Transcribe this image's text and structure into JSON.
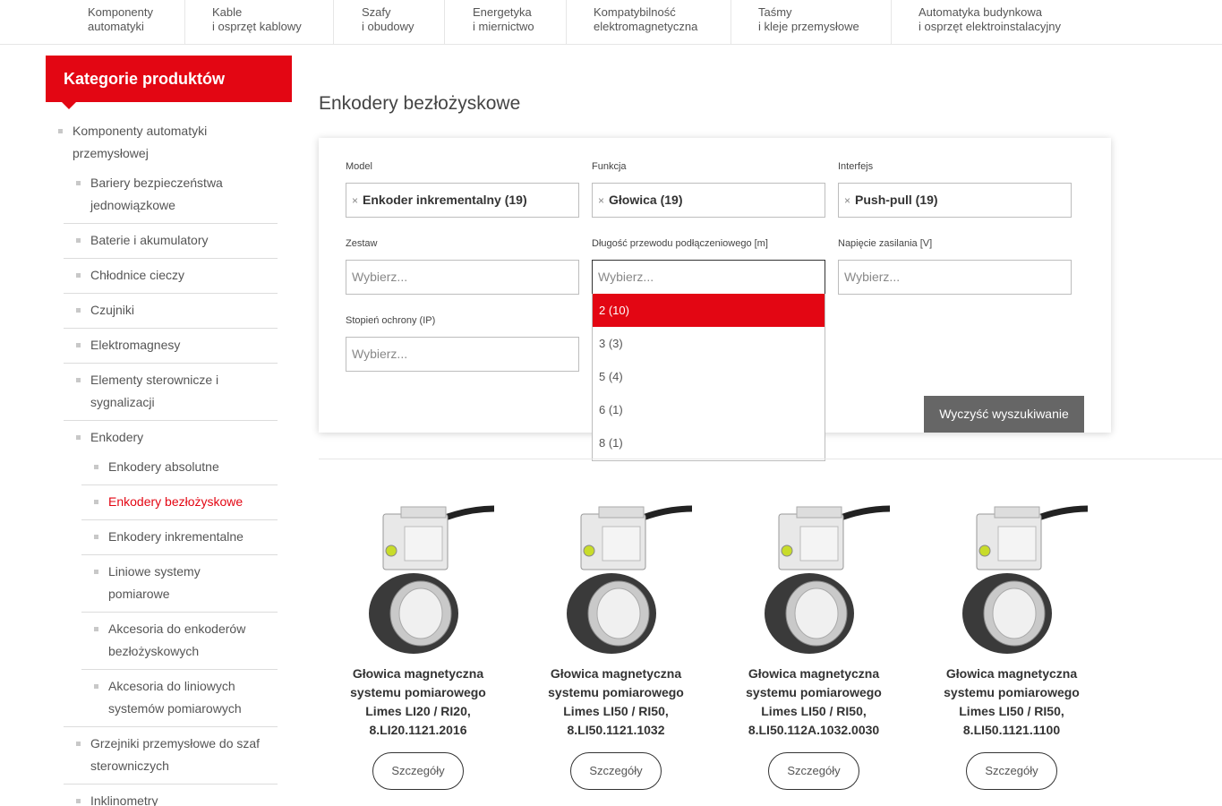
{
  "nav": [
    {
      "line1": "Komponenty",
      "line2": "automatyki"
    },
    {
      "line1": "Kable",
      "line2": "i osprzęt kablowy"
    },
    {
      "line1": "Szafy",
      "line2": "i obudowy"
    },
    {
      "line1": "Energetyka",
      "line2": "i miernictwo"
    },
    {
      "line1": "Kompatybilność",
      "line2": "elektromagnetyczna"
    },
    {
      "line1": "Taśmy",
      "line2": "i kleje przemysłowe"
    },
    {
      "line1": "Automatyka budynkowa",
      "line2": "i osprzęt elektroinstalacyjny"
    }
  ],
  "sidebar": {
    "title": "Kategorie produktów",
    "root": {
      "line1": "Komponenty automatyki",
      "line2": "przemysłowej"
    },
    "items": [
      {
        "line1": "Bariery bezpieczeństwa",
        "line2": "jednowiązkowe"
      },
      {
        "line1": "Baterie i akumulatory"
      },
      {
        "line1": "Chłodnice cieczy"
      },
      {
        "line1": "Czujniki"
      },
      {
        "line1": "Elektromagnesy"
      },
      {
        "line1": "Elementy sterownicze i",
        "line2": "sygnalizacji"
      },
      {
        "line1": "Enkodery"
      }
    ],
    "sub": [
      {
        "line1": "Enkodery absolutne"
      },
      {
        "line1": "Enkodery bezłożyskowe"
      },
      {
        "line1": "Enkodery inkrementalne"
      },
      {
        "line1": "Liniowe systemy",
        "line2": "pomiarowe"
      },
      {
        "line1": "Akcesoria do enkoderów",
        "line2": "bezłożyskowych"
      },
      {
        "line1": "Akcesoria do liniowych",
        "line2": "systemów pomiarowych"
      }
    ],
    "after": [
      {
        "line1": "Grzejniki przemysłowe do szaf",
        "line2": "sterowniczych"
      },
      {
        "line1": "Inklinometry"
      }
    ]
  },
  "page_title": "Enkodery bezłożyskowe",
  "filters": {
    "model": {
      "label": "Model",
      "value": "Enkoder inkrementalny (19)"
    },
    "funkcja": {
      "label": "Funkcja",
      "value": "Głowica (19)"
    },
    "interfejs": {
      "label": "Interfejs",
      "value": "Push-pull (19)"
    },
    "zestaw": {
      "label": "Zestaw",
      "placeholder": "Wybierz..."
    },
    "dlugosc": {
      "label": "Długość przewodu podłączeniowego [m]",
      "placeholder": "Wybierz..."
    },
    "napiecie": {
      "label": "Napięcie zasilania [V]",
      "placeholder": "Wybierz..."
    },
    "ip": {
      "label": "Stopień ochrony (IP)",
      "placeholder": "Wybierz..."
    },
    "remove_symbol": "×",
    "dropdown_options": [
      "2 (10)",
      "3 (3)",
      "5 (4)",
      "6 (1)",
      "8 (1)"
    ],
    "clear_label": "Wyczyść wyszukiwanie"
  },
  "products": [
    {
      "line1": "Głowica magnetyczna",
      "line2": "systemu pomiarowego",
      "line3": "Limes LI20 / RI20,",
      "line4": "8.LI20.1121.2016",
      "button": "Szczegóły"
    },
    {
      "line1": "Głowica magnetyczna",
      "line2": "systemu pomiarowego",
      "line3": "Limes LI50 / RI50,",
      "line4": "8.LI50.1121.1032",
      "button": "Szczegóły"
    },
    {
      "line1": "Głowica magnetyczna",
      "line2": "systemu pomiarowego",
      "line3": "Limes LI50 / RI50,",
      "line4": "8.LI50.112A.1032.0030",
      "button": "Szczegóły"
    },
    {
      "line1": "Głowica magnetyczna",
      "line2": "systemu pomiarowego",
      "line3": "Limes LI50 / RI50,",
      "line4": "8.LI50.1121.1100",
      "button": "Szczegóły"
    }
  ],
  "colors": {
    "accent": "#e30613",
    "button_dark": "#666666"
  }
}
